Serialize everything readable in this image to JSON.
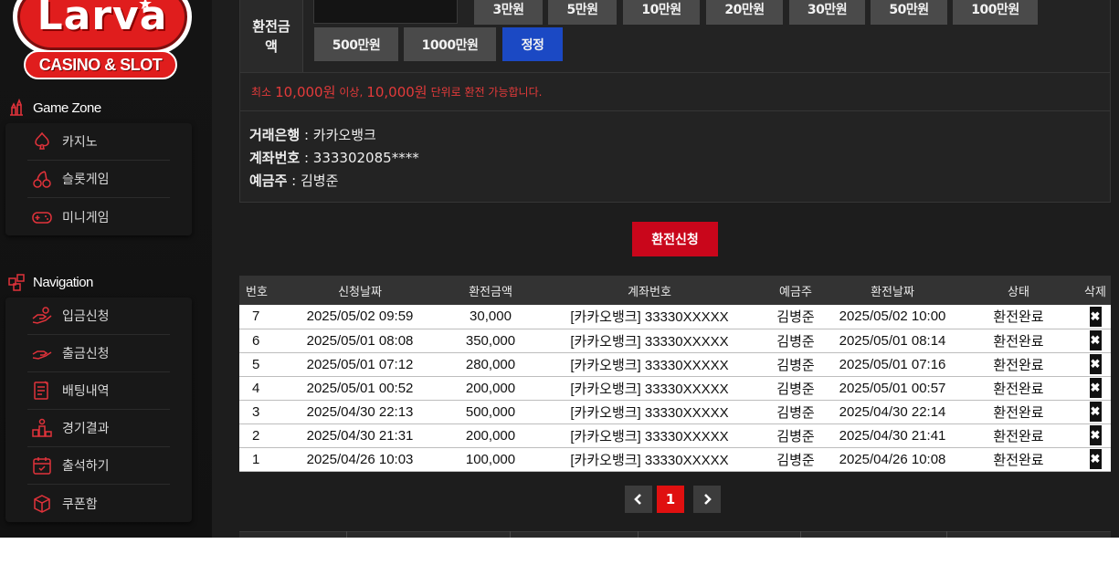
{
  "brand": {
    "name": "Larva",
    "tagline": "CASINO & SLOT",
    "accent": "#e01d1d"
  },
  "sidebar": {
    "game_zone": {
      "title": "Game Zone",
      "items": [
        {
          "label": "카지노",
          "icon": "spade-icon"
        },
        {
          "label": "슬롯게임",
          "icon": "cherry-icon"
        },
        {
          "label": "미니게임",
          "icon": "gamepad-icon"
        }
      ]
    },
    "navigation": {
      "title": "Navigation",
      "items": [
        {
          "label": "입금신청",
          "icon": "deposit-hand-icon"
        },
        {
          "label": "출금신청",
          "icon": "withdraw-hand-icon"
        },
        {
          "label": "배팅내역",
          "icon": "bet-history-icon"
        },
        {
          "label": "경기결과",
          "icon": "trophy-icon"
        },
        {
          "label": "출석하기",
          "icon": "calendar-icon"
        },
        {
          "label": "쿠폰함",
          "icon": "gift-box-icon"
        }
      ]
    }
  },
  "exchange": {
    "amount_label": "환전금액",
    "amount_value": "",
    "amount_buttons": [
      "3만원",
      "5만원",
      "10만원",
      "20만원",
      "30만원",
      "50만원",
      "100만원",
      "500만원",
      "1000만원"
    ],
    "reset_label": "정정",
    "notice": {
      "prefix": "최소",
      "min_amount": "10,000원",
      "mid": "이상,",
      "unit_amount": "10,000원",
      "suffix": "단위로 환전 가능합니다."
    },
    "account": {
      "bank_label": "거래은행",
      "bank_value": "카카오뱅크",
      "number_label": "계좌번호",
      "number_value": "333302085****",
      "holder_label": "예금주",
      "holder_value": "김병준"
    },
    "submit_label": "환전신청"
  },
  "history": {
    "columns": [
      "번호",
      "신청날짜",
      "환전금액",
      "계좌번호",
      "예금주",
      "환전날짜",
      "상태",
      "삭제"
    ],
    "rows": [
      {
        "no": "7",
        "requested": "2025/05/02 09:59",
        "amount": "30,000",
        "account": "[카카오뱅크] 33330XXXXX",
        "holder": "김병준",
        "exchanged": "2025/05/02 10:00",
        "status": "환전완료"
      },
      {
        "no": "6",
        "requested": "2025/05/01 08:08",
        "amount": "350,000",
        "account": "[카카오뱅크] 33330XXXXX",
        "holder": "김병준",
        "exchanged": "2025/05/01 08:14",
        "status": "환전완료"
      },
      {
        "no": "5",
        "requested": "2025/05/01 07:12",
        "amount": "280,000",
        "account": "[카카오뱅크] 33330XXXXX",
        "holder": "김병준",
        "exchanged": "2025/05/01 07:16",
        "status": "환전완료"
      },
      {
        "no": "4",
        "requested": "2025/05/01 00:52",
        "amount": "200,000",
        "account": "[카카오뱅크] 33330XXXXX",
        "holder": "김병준",
        "exchanged": "2025/05/01 00:57",
        "status": "환전완료"
      },
      {
        "no": "3",
        "requested": "2025/04/30 22:13",
        "amount": "500,000",
        "account": "[카카오뱅크] 33330XXXXX",
        "holder": "김병준",
        "exchanged": "2025/04/30 22:14",
        "status": "환전완료"
      },
      {
        "no": "2",
        "requested": "2025/04/30 21:31",
        "amount": "200,000",
        "account": "[카카오뱅크] 33330XXXXX",
        "holder": "김병준",
        "exchanged": "2025/04/30 21:41",
        "status": "환전완료"
      },
      {
        "no": "1",
        "requested": "2025/04/26 10:03",
        "amount": "100,000",
        "account": "[카카오뱅크] 33330XXXXX",
        "holder": "김병준",
        "exchanged": "2025/04/26 10:08",
        "status": "환전완료"
      }
    ],
    "delete_glyph": "✖"
  },
  "pagination": {
    "current": "1",
    "prev_icon": "chevron-left-icon",
    "next_icon": "chevron-right-icon"
  }
}
